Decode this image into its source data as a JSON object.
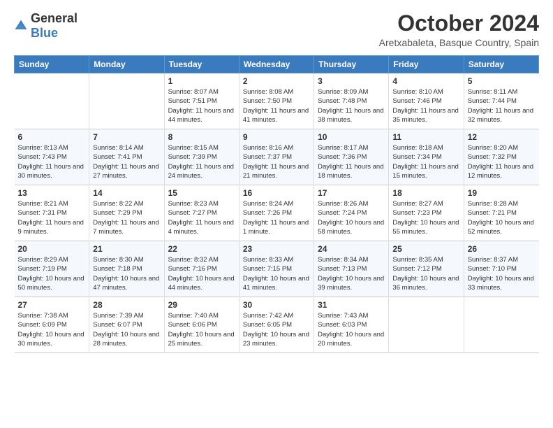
{
  "logo": {
    "general": "General",
    "blue": "Blue"
  },
  "title": "October 2024",
  "location": "Aretxabaleta, Basque Country, Spain",
  "headers": [
    "Sunday",
    "Monday",
    "Tuesday",
    "Wednesday",
    "Thursday",
    "Friday",
    "Saturday"
  ],
  "weeks": [
    [
      {
        "day": "",
        "info": ""
      },
      {
        "day": "",
        "info": ""
      },
      {
        "day": "1",
        "info": "Sunrise: 8:07 AM\nSunset: 7:51 PM\nDaylight: 11 hours and 44 minutes."
      },
      {
        "day": "2",
        "info": "Sunrise: 8:08 AM\nSunset: 7:50 PM\nDaylight: 11 hours and 41 minutes."
      },
      {
        "day": "3",
        "info": "Sunrise: 8:09 AM\nSunset: 7:48 PM\nDaylight: 11 hours and 38 minutes."
      },
      {
        "day": "4",
        "info": "Sunrise: 8:10 AM\nSunset: 7:46 PM\nDaylight: 11 hours and 35 minutes."
      },
      {
        "day": "5",
        "info": "Sunrise: 8:11 AM\nSunset: 7:44 PM\nDaylight: 11 hours and 32 minutes."
      }
    ],
    [
      {
        "day": "6",
        "info": "Sunrise: 8:13 AM\nSunset: 7:43 PM\nDaylight: 11 hours and 30 minutes."
      },
      {
        "day": "7",
        "info": "Sunrise: 8:14 AM\nSunset: 7:41 PM\nDaylight: 11 hours and 27 minutes."
      },
      {
        "day": "8",
        "info": "Sunrise: 8:15 AM\nSunset: 7:39 PM\nDaylight: 11 hours and 24 minutes."
      },
      {
        "day": "9",
        "info": "Sunrise: 8:16 AM\nSunset: 7:37 PM\nDaylight: 11 hours and 21 minutes."
      },
      {
        "day": "10",
        "info": "Sunrise: 8:17 AM\nSunset: 7:36 PM\nDaylight: 11 hours and 18 minutes."
      },
      {
        "day": "11",
        "info": "Sunrise: 8:18 AM\nSunset: 7:34 PM\nDaylight: 11 hours and 15 minutes."
      },
      {
        "day": "12",
        "info": "Sunrise: 8:20 AM\nSunset: 7:32 PM\nDaylight: 11 hours and 12 minutes."
      }
    ],
    [
      {
        "day": "13",
        "info": "Sunrise: 8:21 AM\nSunset: 7:31 PM\nDaylight: 11 hours and 9 minutes."
      },
      {
        "day": "14",
        "info": "Sunrise: 8:22 AM\nSunset: 7:29 PM\nDaylight: 11 hours and 7 minutes."
      },
      {
        "day": "15",
        "info": "Sunrise: 8:23 AM\nSunset: 7:27 PM\nDaylight: 11 hours and 4 minutes."
      },
      {
        "day": "16",
        "info": "Sunrise: 8:24 AM\nSunset: 7:26 PM\nDaylight: 11 hours and 1 minute."
      },
      {
        "day": "17",
        "info": "Sunrise: 8:26 AM\nSunset: 7:24 PM\nDaylight: 10 hours and 58 minutes."
      },
      {
        "day": "18",
        "info": "Sunrise: 8:27 AM\nSunset: 7:23 PM\nDaylight: 10 hours and 55 minutes."
      },
      {
        "day": "19",
        "info": "Sunrise: 8:28 AM\nSunset: 7:21 PM\nDaylight: 10 hours and 52 minutes."
      }
    ],
    [
      {
        "day": "20",
        "info": "Sunrise: 8:29 AM\nSunset: 7:19 PM\nDaylight: 10 hours and 50 minutes."
      },
      {
        "day": "21",
        "info": "Sunrise: 8:30 AM\nSunset: 7:18 PM\nDaylight: 10 hours and 47 minutes."
      },
      {
        "day": "22",
        "info": "Sunrise: 8:32 AM\nSunset: 7:16 PM\nDaylight: 10 hours and 44 minutes."
      },
      {
        "day": "23",
        "info": "Sunrise: 8:33 AM\nSunset: 7:15 PM\nDaylight: 10 hours and 41 minutes."
      },
      {
        "day": "24",
        "info": "Sunrise: 8:34 AM\nSunset: 7:13 PM\nDaylight: 10 hours and 39 minutes."
      },
      {
        "day": "25",
        "info": "Sunrise: 8:35 AM\nSunset: 7:12 PM\nDaylight: 10 hours and 36 minutes."
      },
      {
        "day": "26",
        "info": "Sunrise: 8:37 AM\nSunset: 7:10 PM\nDaylight: 10 hours and 33 minutes."
      }
    ],
    [
      {
        "day": "27",
        "info": "Sunrise: 7:38 AM\nSunset: 6:09 PM\nDaylight: 10 hours and 30 minutes."
      },
      {
        "day": "28",
        "info": "Sunrise: 7:39 AM\nSunset: 6:07 PM\nDaylight: 10 hours and 28 minutes."
      },
      {
        "day": "29",
        "info": "Sunrise: 7:40 AM\nSunset: 6:06 PM\nDaylight: 10 hours and 25 minutes."
      },
      {
        "day": "30",
        "info": "Sunrise: 7:42 AM\nSunset: 6:05 PM\nDaylight: 10 hours and 23 minutes."
      },
      {
        "day": "31",
        "info": "Sunrise: 7:43 AM\nSunset: 6:03 PM\nDaylight: 10 hours and 20 minutes."
      },
      {
        "day": "",
        "info": ""
      },
      {
        "day": "",
        "info": ""
      }
    ]
  ]
}
